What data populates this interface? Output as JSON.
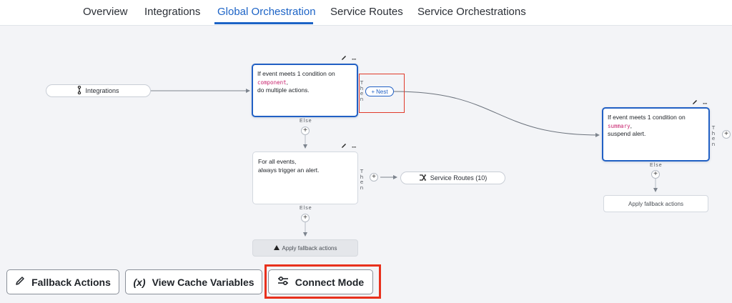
{
  "tabs": [
    {
      "label": "Overview"
    },
    {
      "label": "Integrations"
    },
    {
      "label": "Global Orchestration"
    },
    {
      "label": "Service Routes"
    },
    {
      "label": "Service Orchestrations"
    }
  ],
  "active_tab": "Global Orchestration",
  "integrations_pill": {
    "label": "Integrations",
    "icon": "integration-icon"
  },
  "rule1": {
    "line1": "If event meets 1 condition on",
    "code": "component",
    "code_suffix": ",",
    "line3": "do multiple actions."
  },
  "rule2": {
    "line1": "For all events,",
    "line2": "always trigger an alert."
  },
  "rule3": {
    "line1": "If event meets 1 condition on",
    "code": "summary",
    "code_suffix": ",",
    "line3": "suspend alert."
  },
  "labels": {
    "then": "Then",
    "else": "Else",
    "plus": "+",
    "dots": "···"
  },
  "nest_button": {
    "label": "Nest",
    "plus": "+"
  },
  "service_routes_pill": {
    "label": "Service Routes (10)",
    "icon": "route-icon"
  },
  "fallback_disabled": {
    "label": "Apply fallback actions",
    "icon": "warning-icon"
  },
  "fallback_right": {
    "label": "Apply fallback actions"
  },
  "buttons": {
    "fallback": {
      "label": "Fallback Actions",
      "icon": "pencil-icon"
    },
    "cache": {
      "label": "View Cache Variables",
      "icon_text": "(x)"
    },
    "connect": {
      "label": "Connect Mode",
      "icon": "sliders-icon"
    }
  },
  "colors": {
    "accent": "#1c63c6",
    "highlight": "#e8311d",
    "code": "#c8246e"
  }
}
